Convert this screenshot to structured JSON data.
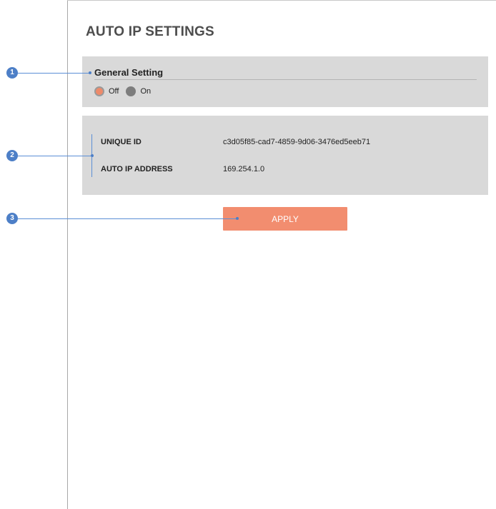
{
  "page": {
    "title": "AUTO IP SETTINGS"
  },
  "general": {
    "heading": "General Setting",
    "options": [
      {
        "label": "Off",
        "selected": true
      },
      {
        "label": "On",
        "selected": false
      }
    ]
  },
  "info": {
    "unique_id_label": "UNIQUE ID",
    "unique_id_value": "c3d05f85-cad7-4859-9d06-3476ed5eeb71",
    "auto_ip_label": "AUTO IP ADDRESS",
    "auto_ip_value": "169.254.1.0"
  },
  "actions": {
    "apply_label": "APPLY"
  },
  "callouts": [
    "1",
    "2",
    "3"
  ],
  "colors": {
    "accent": "#f28d6f",
    "callout": "#4d7fc7",
    "panel": "#d9d9d9"
  }
}
